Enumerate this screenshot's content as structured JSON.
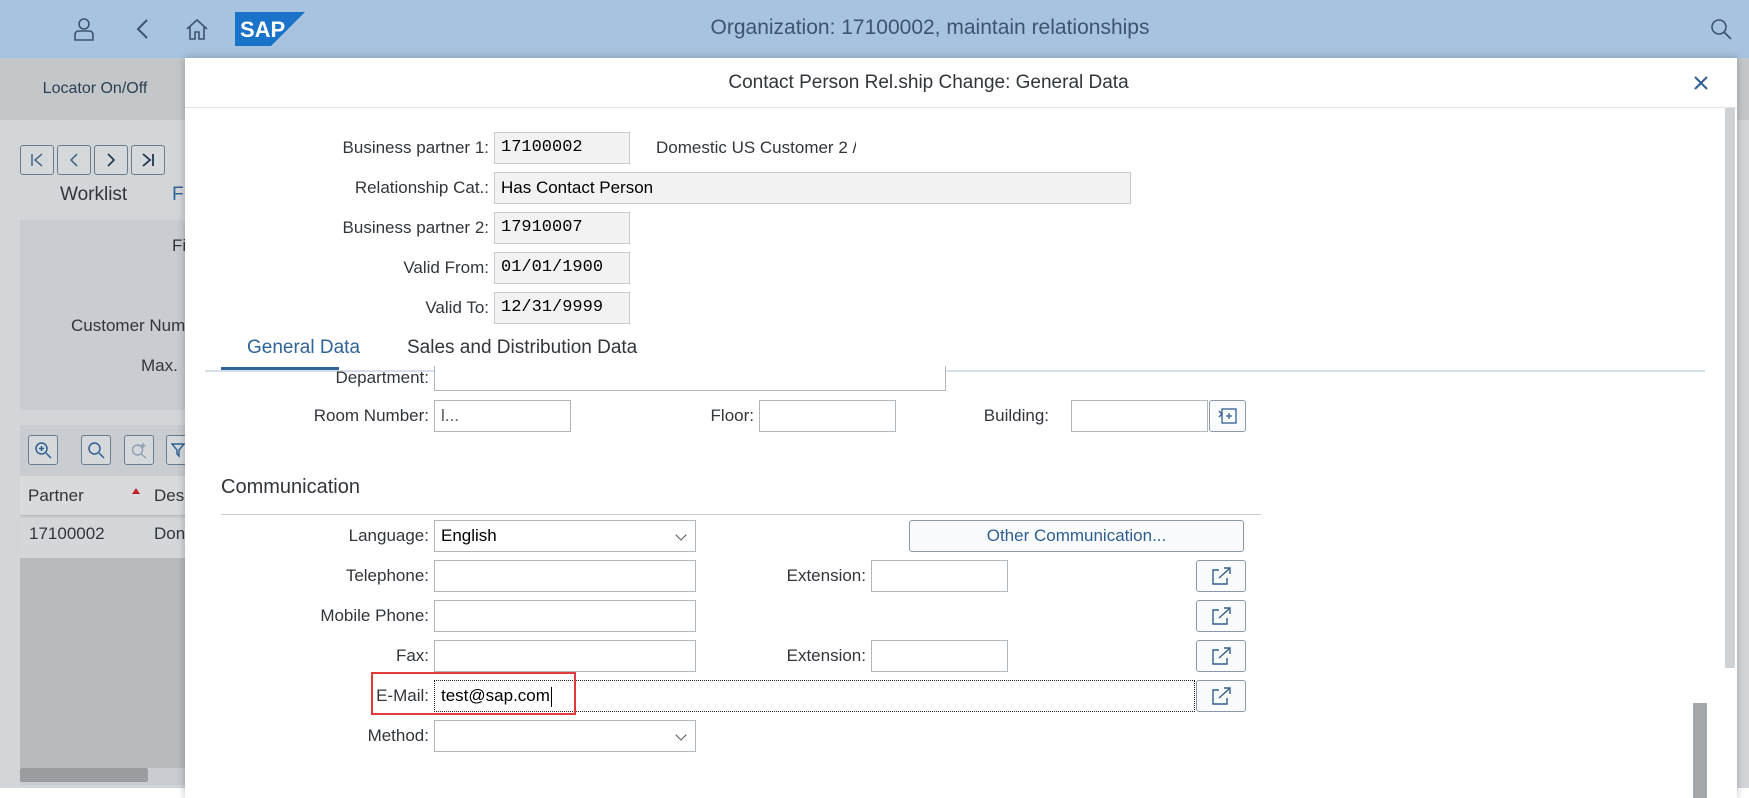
{
  "shell": {
    "title": "Organization: 17100002, maintain relationships",
    "logo": "SAP",
    "icons": [
      "user-icon",
      "back-icon",
      "home-icon",
      "search-icon"
    ]
  },
  "background": {
    "locator_label": "Locator On/Off",
    "tabs": [
      "Worklist",
      "F"
    ],
    "field_label_1": "Fi",
    "field_label_2": "Customer Num",
    "field_label_3": "Max.",
    "table": {
      "headers": [
        "Partner",
        "Desc"
      ],
      "rows": [
        [
          "17100002",
          "Don"
        ]
      ]
    }
  },
  "dialog": {
    "title": "Contact Person Rel.ship Change: General Data",
    "header_fields": {
      "bp1_label": "Business partner 1:",
      "bp1_value": "17100002",
      "bp1_desc": "Domestic US Customer 2 /",
      "relcat_label": "Relationship Cat.:",
      "relcat_value": "Has Contact Person",
      "bp2_label": "Business partner 2:",
      "bp2_value": "17910007",
      "valid_from_label": "Valid From:",
      "valid_from_value": "01/01/1900",
      "valid_to_label": "Valid To:",
      "valid_to_value": "12/31/9999"
    },
    "tabs": [
      "General Data",
      "Sales and Distribution Data"
    ],
    "address": {
      "department_label": "Department:",
      "department_value": "",
      "room_label": "Room Number:",
      "room_value": "l...",
      "floor_label": "Floor:",
      "floor_value": "",
      "building_label": "Building:",
      "building_value": ""
    },
    "communication": {
      "title": "Communication",
      "language_label": "Language:",
      "language_value": "English",
      "other_button": "Other Communication...",
      "telephone_label": "Telephone:",
      "telephone_value": "",
      "tel_ext_label": "Extension:",
      "tel_ext_value": "",
      "mobile_label": "Mobile Phone:",
      "mobile_value": "",
      "fax_label": "Fax:",
      "fax_value": "",
      "fax_ext_label": "Extension:",
      "fax_ext_value": "",
      "email_label": "E-Mail:",
      "email_value": "test@sap.com",
      "method_label": "Method:",
      "method_value": ""
    }
  },
  "colors": {
    "shell_bg": "#a8c3df",
    "accent": "#2f6497",
    "highlight": "#e0393e"
  }
}
